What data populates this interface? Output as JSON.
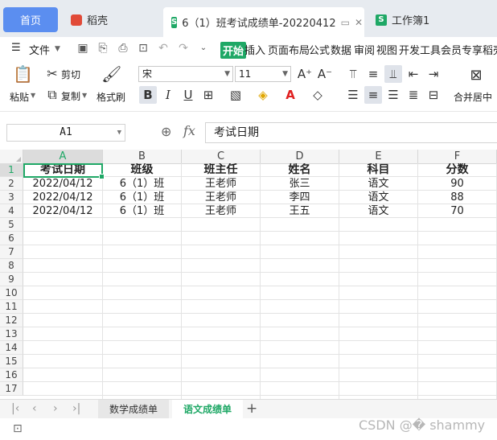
{
  "tabs": {
    "home": "首页",
    "docer": "稻壳",
    "doc_badge": "S",
    "doc_title": "6（1）班考试成绩单-20220412",
    "wb_badge": "S",
    "wb_title": "工作簿1"
  },
  "menu": {
    "file": "文件",
    "start": "开始",
    "items": [
      "插入",
      "页面布局",
      "公式",
      "数据",
      "审阅",
      "视图",
      "开发工具",
      "会员专享",
      "稻壳"
    ]
  },
  "ribbon": {
    "paste": "粘贴",
    "cut": "剪切",
    "copy": "复制",
    "painter": "格式刷",
    "font_name": "宋",
    "font_size": "11",
    "merge": "合并居中"
  },
  "formula_bar": {
    "name_box": "A1",
    "fx": "fx",
    "content": "考试日期"
  },
  "sheet": {
    "columns": [
      "A",
      "B",
      "C",
      "D",
      "E",
      "F"
    ],
    "rows": [
      "1",
      "2",
      "3",
      "4",
      "5",
      "6",
      "7",
      "8",
      "9",
      "10",
      "11",
      "12",
      "13",
      "14",
      "15",
      "16",
      "17"
    ],
    "header": [
      "考试日期",
      "班级",
      "班主任",
      "姓名",
      "科目",
      "分数"
    ],
    "data": [
      [
        "2022/04/12",
        "6（1）班",
        "王老师",
        "张三",
        "语文",
        "90"
      ],
      [
        "2022/04/12",
        "6（1）班",
        "王老师",
        "李四",
        "语文",
        "88"
      ],
      [
        "2022/04/12",
        "6（1）班",
        "王老师",
        "王五",
        "语文",
        "70"
      ]
    ]
  },
  "sheet_tabs": {
    "inactive": "数学成绩单",
    "active": "语文成绩单"
  },
  "watermark": "CSDN @� shammy",
  "colors": {
    "accent": "#1fa866",
    "home_tab": "#5b8ef0"
  }
}
